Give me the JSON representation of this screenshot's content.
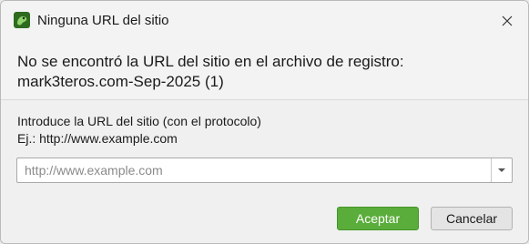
{
  "window": {
    "title": "Ninguna URL del sitio",
    "icon": "frog-app-icon",
    "close_icon": "close-icon"
  },
  "message": {
    "line1": "No se encontró la URL del sitio en el archivo de registro:",
    "line2": "mark3teros.com-Sep-2025 (1)"
  },
  "prompt": {
    "line1": "Introduce la URL del sitio (con el protocolo)",
    "line2": "Ej.: http://www.example.com"
  },
  "url_field": {
    "value": "",
    "placeholder": "http://www.example.com",
    "dropdown_icon": "chevron-down-icon"
  },
  "buttons": {
    "accept_label": "Aceptar",
    "cancel_label": "Cancelar"
  },
  "colors": {
    "accent": "#5aad3a"
  }
}
